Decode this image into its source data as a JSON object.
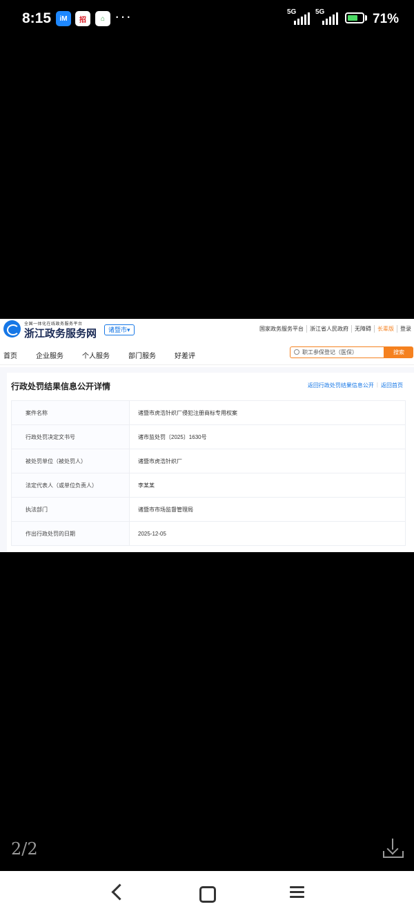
{
  "status_bar": {
    "time": "8:15",
    "apps": [
      "iM",
      "招",
      "⌂"
    ],
    "more": "···",
    "signal1": "5G",
    "signal2": "5G",
    "battery_percent": "71%",
    "battery_level": 0.71
  },
  "site": {
    "logo_small": "全国一体化在线政务服务平台",
    "logo_title": "浙江政务服务网",
    "city": "诸暨市▾",
    "top_links": [
      "国家政务服务平台",
      "浙江省人民政府",
      "无障碍",
      "长辈版",
      "登录"
    ],
    "nav": [
      "首页",
      "企业服务",
      "个人服务",
      "部门服务",
      "好差评"
    ],
    "search_placeholder": "职工参保登记（医保）",
    "search_button": "搜索"
  },
  "detail": {
    "title": "行政处罚结果信息公开详情",
    "links": [
      "返回行政处罚结果信息公开",
      "返回首页"
    ],
    "rows": [
      {
        "label": "案件名称",
        "value": "诸暨市虎浩针织厂侵犯注册商标专用权案"
      },
      {
        "label": "行政处罚决定文书号",
        "value": "诸市监处罚〔2025〕1630号"
      },
      {
        "label": "被处罚单位（被处罚人）",
        "value": "诸暨市虎浩针织厂"
      },
      {
        "label": "法定代表人（或单位负责人）",
        "value": "李某某"
      },
      {
        "label": "执法部门",
        "value": "诸暨市市场监督管理局"
      },
      {
        "label": "作出行政处罚的日期",
        "value": "2025-12-05"
      }
    ]
  },
  "viewer": {
    "page_indicator": "2/2"
  }
}
